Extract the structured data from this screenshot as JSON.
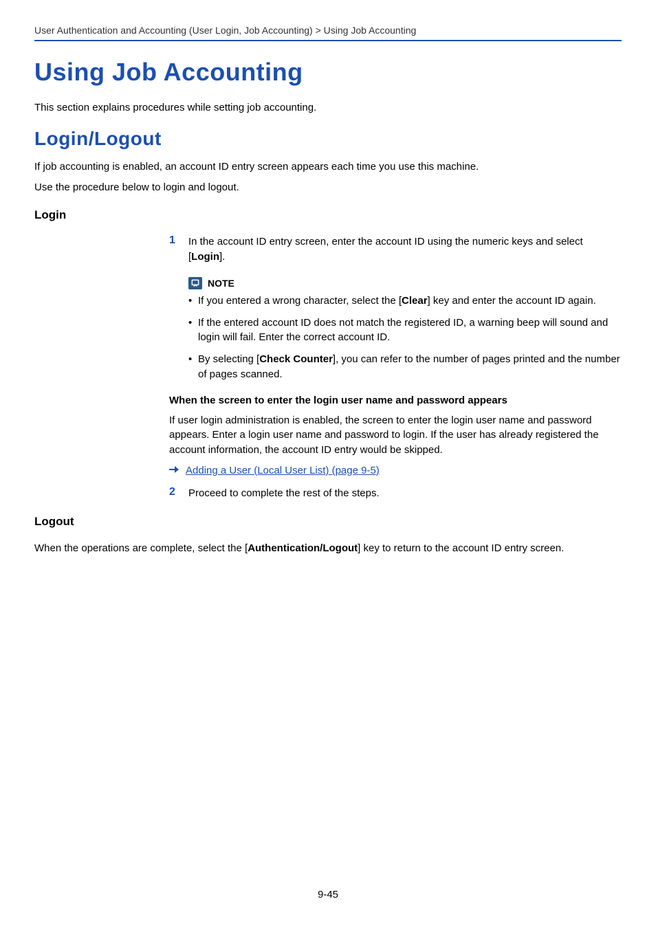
{
  "breadcrumb": "User Authentication and Accounting (User Login, Job Accounting) > Using Job Accounting",
  "h1": "Using Job Accounting",
  "intro": "This section explains procedures while setting job accounting.",
  "h2": "Login/Logout",
  "p2a": "If job accounting is enabled, an account ID entry screen appears each time you use this machine.",
  "p2b": "Use the procedure below to login and logout.",
  "login": {
    "heading": "Login",
    "step1_num": "1",
    "step1_a": "In the account ID entry screen, enter the account ID using the numeric keys and select [",
    "step1_b": "Login",
    "step1_c": "].",
    "note_label": "NOTE",
    "bullets": {
      "b1_a": "If you entered a wrong character, select the [",
      "b1_b": "Clear",
      "b1_c": "] key and enter the account ID again.",
      "b2": "If the entered account ID does not match the registered ID, a warning beep will sound and login will fail. Enter the correct account ID.",
      "b3_a": "By selecting [",
      "b3_b": "Check Counter",
      "b3_c": "], you can refer to the number of pages printed and the number of pages scanned."
    },
    "sub_heading": "When the screen to enter the login user name and password appears",
    "sub_para": "If user login administration is enabled, the screen to enter the login user name and password appears. Enter a login user name and password to login. If the user has already registered the account information, the account ID entry would be skipped.",
    "xref": "Adding a User (Local User List) (page 9-5)",
    "step2_num": "2",
    "step2_text": "Proceed to complete the rest of the steps."
  },
  "logout": {
    "heading": "Logout",
    "p_a": "When the operations are complete, select the [",
    "p_b": "Authentication/Logout",
    "p_c": "] key to return to the account ID entry screen."
  },
  "page_number": "9-45"
}
